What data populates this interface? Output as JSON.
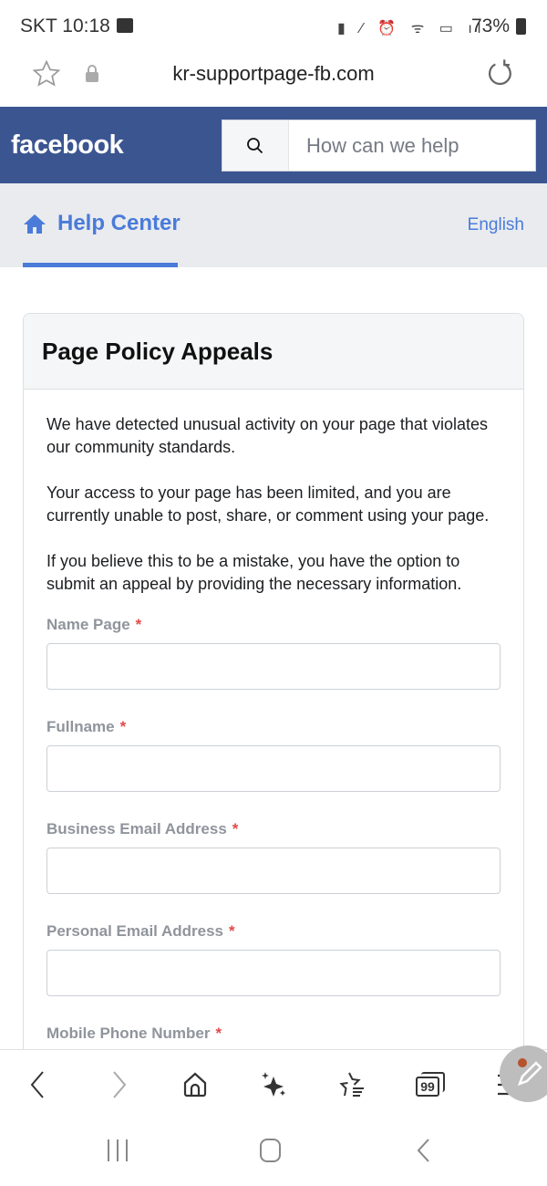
{
  "status_bar": {
    "carrier_time": "SKT 10:18",
    "battery": "73%"
  },
  "browser": {
    "url": "kr-supportpage-fb.com"
  },
  "header": {
    "logo": "facebook",
    "search_placeholder": "How can we help"
  },
  "nav": {
    "title": "Help Center",
    "language": "English"
  },
  "card": {
    "title": "Page Policy Appeals",
    "paragraphs": [
      "We have detected unusual activity on your page that violates our community standards.",
      "Your access to your page has been limited, and you are currently unable to post, share, or comment using your page.",
      "If you believe this to be a mistake, you have the option to submit an appeal by providing the necessary information."
    ],
    "fields": [
      {
        "label": "Name Page",
        "required": "*",
        "value": ""
      },
      {
        "label": "Fullname",
        "required": "*",
        "value": ""
      },
      {
        "label": "Business Email Address",
        "required": "*",
        "value": ""
      },
      {
        "label": "Personal Email Address",
        "required": "*",
        "value": ""
      },
      {
        "label": "Mobile Phone Number",
        "required": "*",
        "value": ""
      }
    ]
  },
  "colors": {
    "brand": "#3b5591",
    "accent": "#4a7bd9",
    "required": "#e04a4a"
  },
  "toolbar": {
    "tabs_count": "99"
  }
}
